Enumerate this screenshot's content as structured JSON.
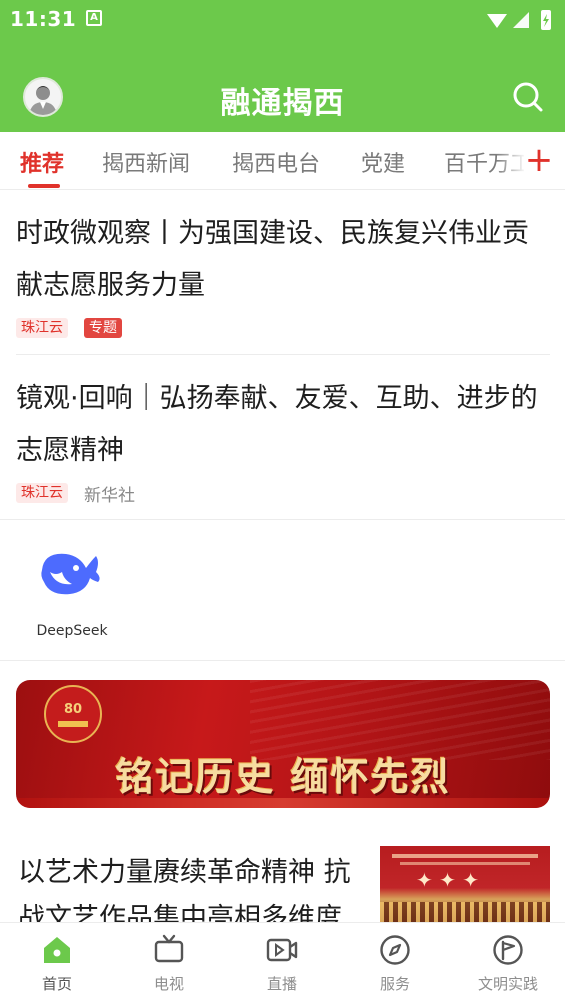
{
  "status_bar": {
    "time": "11:31",
    "notification_letter": "A"
  },
  "header": {
    "title": "融通揭西"
  },
  "tabs": [
    {
      "label": "推荐",
      "active": true
    },
    {
      "label": "揭西新闻"
    },
    {
      "label": "揭西电台"
    },
    {
      "label": "党建"
    },
    {
      "label": "百千万工"
    }
  ],
  "articles": [
    {
      "title": "时政微观察丨为强国建设、民族复兴伟业贡献志愿服务力量",
      "source_tag": "珠江云",
      "special_tag": "专题"
    },
    {
      "title": "镜观·回响｜弘扬奉献、友爱、互助、进步的志愿精神",
      "source_tag": "珠江云",
      "source": "新华社"
    }
  ],
  "deepseek": {
    "label": "DeepSeek"
  },
  "banner": {
    "emblem_text": "80",
    "text": "铭记历史 缅怀先烈"
  },
  "article3": {
    "title": "以艺术力量赓续革命精神 抗战文艺作品集中亮相多维度"
  },
  "bottom_nav": [
    {
      "label": "首页",
      "icon": "home-icon",
      "active": true
    },
    {
      "label": "电视",
      "icon": "tv-icon"
    },
    {
      "label": "直播",
      "icon": "live-camera-icon"
    },
    {
      "label": "服务",
      "icon": "compass-icon"
    },
    {
      "label": "文明实践",
      "icon": "flag-circle-icon"
    }
  ],
  "colors": {
    "brand_green": "#6cc94b",
    "accent_red": "#e0322b",
    "deepseek_blue": "#4d6bfe"
  }
}
